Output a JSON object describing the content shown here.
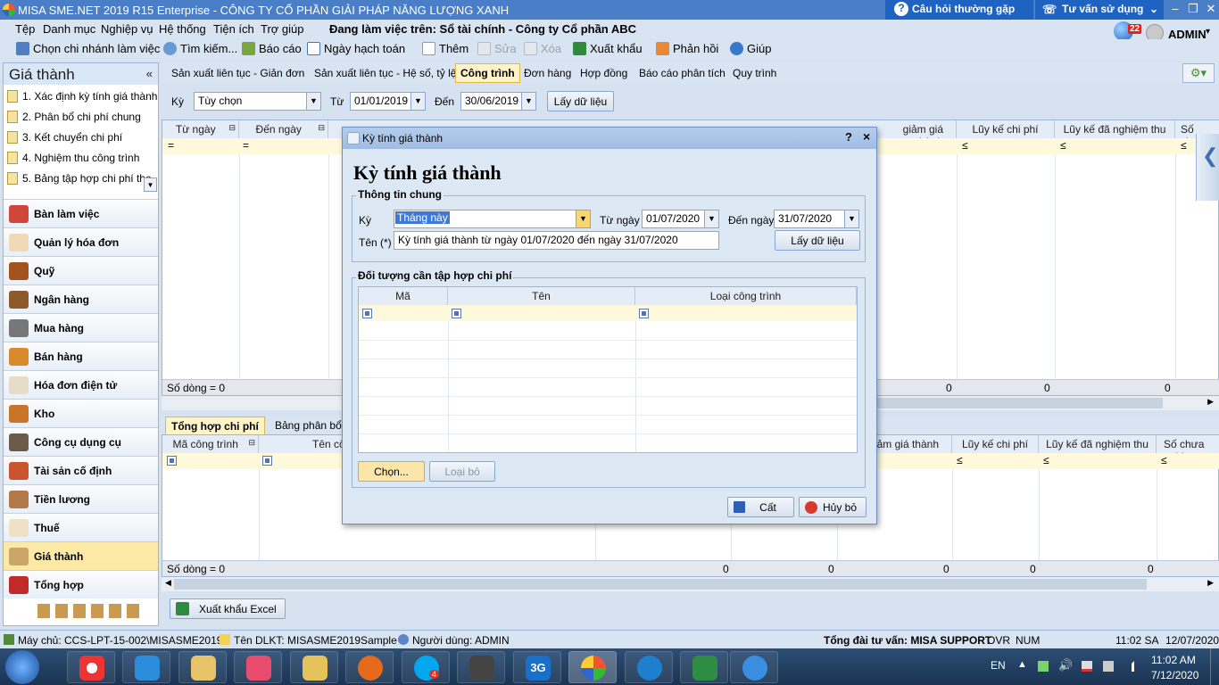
{
  "window": {
    "title": "MISA SME.NET 2019 R15 Enterprise - CÔNG TY CỔ PHẦN GIẢI PHÁP NĂNG LƯỢNG XANH",
    "faq_label": "Câu hỏi thường gặp",
    "advice_label": "Tư vấn sử dụng"
  },
  "menu": {
    "items": [
      "Tệp",
      "Danh mục",
      "Nghiệp vụ",
      "Hệ thống",
      "Tiện ích",
      "Trợ giúp"
    ],
    "workspace": "Đang làm việc trên: Sổ tài chính - Công ty Cổ phần ABC",
    "notif_count": "22",
    "user": "ADMIN"
  },
  "toolbar": {
    "branch": "Chọn chi nhánh làm việc",
    "search": "Tìm kiếm...",
    "report": "Báo cáo",
    "posting_date": "Ngày hạch toán",
    "add": "Thêm",
    "edit": "Sửa",
    "delete": "Xóa",
    "export": "Xuất khẩu",
    "feedback": "Phản hồi",
    "help": "Giúp"
  },
  "left": {
    "title": "Giá thành",
    "steps": [
      "1. Xác định kỳ tính giá thành",
      "2. Phân bổ chi phí chung",
      "3. Kết chuyển chi phí",
      "4. Nghiệm thu công trình",
      "5. Bảng tập hợp chi phí the"
    ],
    "nav": [
      "Bàn làm việc",
      "Quản lý hóa đơn",
      "Quỹ",
      "Ngân hàng",
      "Mua hàng",
      "Bán hàng",
      "Hóa đơn điện tử",
      "Kho",
      "Công cụ dụng cụ",
      "Tài sản cố định",
      "Tiền lương",
      "Thuế",
      "Giá thành",
      "Tổng hợp"
    ]
  },
  "tabs": [
    "Sản xuất liên tục - Giản đơn",
    "Sản xuất liên tục - Hệ số, tỷ lệ",
    "Công trình",
    "Đơn hàng",
    "Hợp đồng",
    "Báo cáo phân tích",
    "Quy trình"
  ],
  "filter": {
    "ky_label": "Kỳ",
    "ky_value": "Tùy chọn",
    "from_label": "Từ",
    "from_value": "01/01/2019",
    "to_label": "Đến",
    "to_value": "30/06/2019",
    "fetch": "Lấy dữ liệu"
  },
  "grid1": {
    "headers": [
      "Từ ngày",
      "Đến ngày",
      "giảm giá thành",
      "Lũy kế chi phí",
      "Lũy kế đã nghiệm thu",
      "Số chưa"
    ],
    "filter_ops": [
      "=",
      "=",
      "≤",
      "≤",
      "≤"
    ],
    "rowcount": "Số dòng = 0",
    "totals": [
      "0",
      "0",
      "0"
    ]
  },
  "tabs2": [
    "Tổng hợp chi phí",
    "Bảng phân bổ c"
  ],
  "grid2": {
    "headers": [
      "Mã công trình",
      "Tên cô",
      "giảm giá thành",
      "Lũy kế chi phí",
      "Lũy kế đã nghiệm thu",
      "Số chưa nghi"
    ],
    "filter_ops": [
      "≤",
      "≤",
      "≤"
    ],
    "rowcount": "Số dòng = 0",
    "totals": [
      "0",
      "0",
      "0",
      "0",
      "0"
    ]
  },
  "export_excel": "Xuất khẩu Excel",
  "dialog": {
    "title": "Kỳ tính giá thành",
    "heading": "Kỳ tính giá thành",
    "help": "?",
    "close": "×",
    "group1": "Thông tin chung",
    "ky_label": "Kỳ",
    "ky_value": "Tháng này",
    "from_label": "Từ ngày",
    "from_value": "01/07/2020",
    "to_label": "Đến ngày",
    "to_value": "31/07/2020",
    "name_label": "Tên (*)",
    "name_value": "Kỳ tính giá thành từ ngày 01/07/2020 đến ngày 31/07/2020",
    "fetch": "Lấy dữ liệu",
    "group2": "Đối tượng cần tập hợp chi phí",
    "cols": [
      "Mã",
      "Tên",
      "Loại công trình"
    ],
    "choose": "Chọn...",
    "remove": "Loại bỏ",
    "save": "Cất",
    "cancel": "Hủy bỏ"
  },
  "status": {
    "server": "Máy chủ: CCS-LPT-15-002\\MISASME2019",
    "db": "Tên DLKT: MISASME2019Sample",
    "user": "Người dùng: ADMIN",
    "hotline": "Tổng đài tư vấn: MISA SUPPORT",
    "ovr": "OVR",
    "num": "NUM",
    "time": "11:02 SA",
    "date": "12/07/2020"
  },
  "taskbar": {
    "lang": "EN",
    "time": "11:02 AM",
    "date": "7/12/2020",
    "skype_badge": "4",
    "app_3g": "3G"
  }
}
